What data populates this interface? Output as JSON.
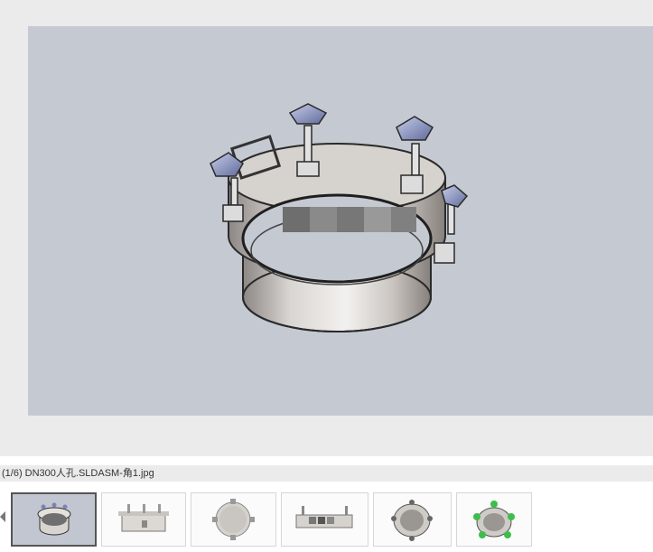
{
  "caption": "(1/6) DN300人孔.SLDASM-角1.jpg",
  "main_image": {
    "description_icon": "manway-3d-render"
  },
  "thumbnails": [
    {
      "icon": "manway-render-angle-1",
      "selected": true
    },
    {
      "icon": "manway-render-side",
      "selected": false
    },
    {
      "icon": "manway-render-top",
      "selected": false
    },
    {
      "icon": "manway-render-front",
      "selected": false
    },
    {
      "icon": "manway-render-iso",
      "selected": false
    },
    {
      "icon": "manway-render-iso-green",
      "selected": false
    }
  ],
  "colors": {
    "viewer_bg": "#ebebeb",
    "image_bg": "#c5c9d2",
    "selected_border": "#555555"
  }
}
